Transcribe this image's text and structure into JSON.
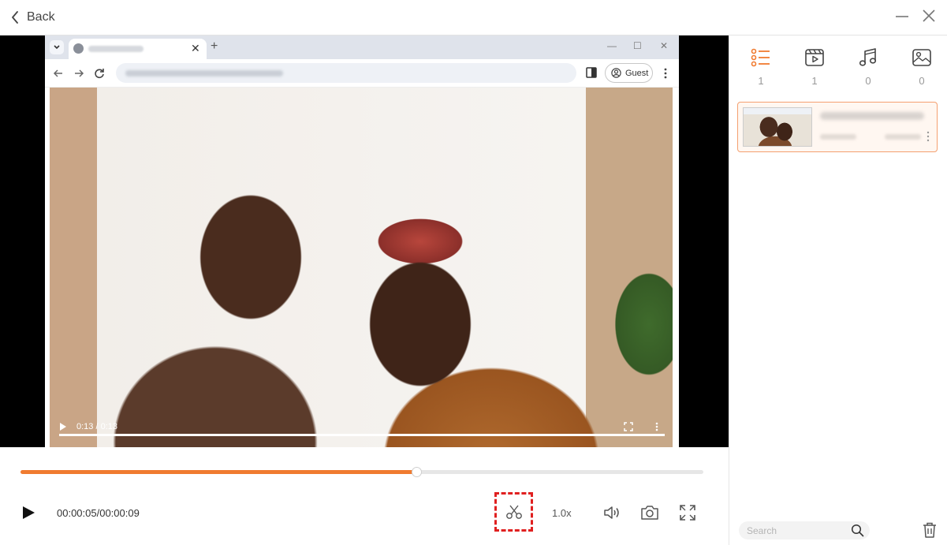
{
  "titlebar": {
    "back_label": "Back",
    "icons": {
      "back": "chevron-left-icon",
      "minimize": "minimize-icon",
      "close": "close-icon"
    }
  },
  "browser": {
    "guest_label": "Guest"
  },
  "video_overlay": {
    "time": "0:13 / 0:13"
  },
  "player": {
    "current_time": "00:00:05",
    "total_time": "00:00:09",
    "time_display": "00:00:05/00:00:09",
    "progress_fraction": 0.58,
    "speed_label": "1.0x",
    "accent_color": "#f07b30",
    "icons": {
      "play": "play-icon",
      "cut": "scissors-icon",
      "volume": "volume-icon",
      "snapshot": "camera-icon",
      "fullscreen": "fullscreen-icon"
    }
  },
  "sidebar": {
    "categories": [
      {
        "name": "all",
        "icon": "list-icon",
        "count": "1",
        "active": true
      },
      {
        "name": "video",
        "icon": "video-icon",
        "count": "1",
        "active": false
      },
      {
        "name": "audio",
        "icon": "music-icon",
        "count": "0",
        "active": false
      },
      {
        "name": "image",
        "icon": "image-icon",
        "count": "0",
        "active": false
      }
    ],
    "search": {
      "placeholder": "Search"
    },
    "icons": {
      "search": "search-icon",
      "delete": "trash-icon"
    }
  }
}
